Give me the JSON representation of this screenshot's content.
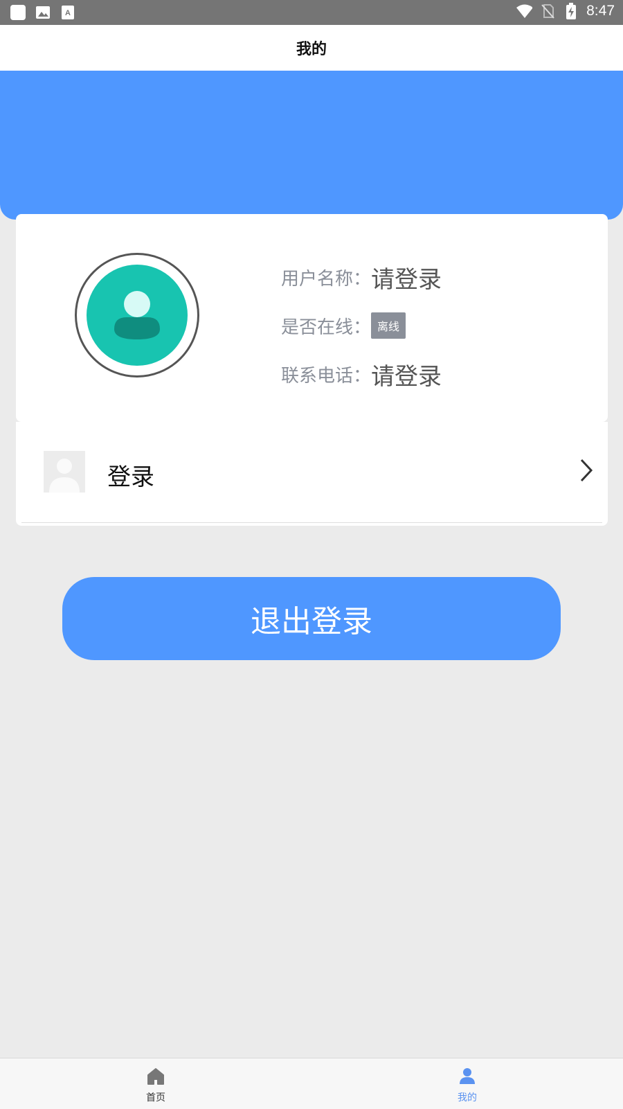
{
  "status_bar": {
    "time": "8:47",
    "icons": [
      "app-icon",
      "image-icon",
      "text-icon",
      "wifi-icon",
      "no-sim-icon",
      "battery-charging-icon"
    ]
  },
  "header": {
    "title": "我的"
  },
  "colors": {
    "accent": "#4f97ff",
    "avatar_bg": "#18c4b0",
    "tag_gray": "#8a8f99"
  },
  "profile": {
    "username_label": "用户名称：",
    "username_value": "请登录",
    "online_label": "是否在线：",
    "online_status": "离线",
    "phone_label": "联系电话：",
    "phone_value": "请登录"
  },
  "login_item": {
    "label": "登录"
  },
  "logout_button": {
    "label": "退出登录"
  },
  "tabs": [
    {
      "label": "首页",
      "icon": "home-icon",
      "active": false
    },
    {
      "label": "我的",
      "icon": "user-icon",
      "active": true
    }
  ]
}
